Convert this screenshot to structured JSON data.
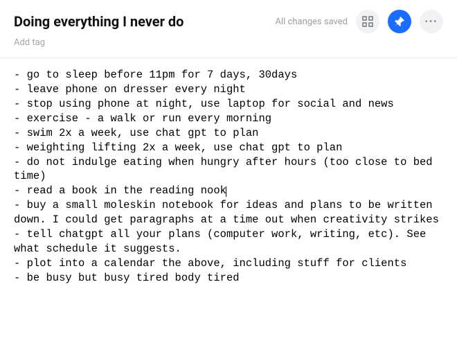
{
  "header": {
    "title": "Doing everything I never do",
    "status": "All changes saved",
    "icons": {
      "grid": "grid-icon",
      "pin": "pin-icon",
      "more": "more-icon"
    }
  },
  "tag": {
    "placeholder": "Add tag"
  },
  "note": {
    "lines": [
      "- go to sleep before 11pm for 7 days, 30days",
      "- leave phone on dresser every night",
      "- stop using phone at night, use laptop for social and news",
      "- exercise - a walk or run every morning",
      "- swim 2x a week, use chat gpt to plan",
      "- weighting lifting 2x a week, use chat gpt to plan",
      "- do not indulge eating when hungry after hours (too close to bed time)",
      "- read a book in the reading nook",
      "- buy a small moleskin notebook for ideas and plans to be written down. I could get paragraphs at a time out when creativity strikes",
      "- tell chatgpt all your plans (computer work, writing, etc). See what schedule it suggests.",
      "- plot into a calendar the above, including stuff for clients",
      "- be busy but busy tired body tired"
    ],
    "caret_after_line_index": 7
  }
}
